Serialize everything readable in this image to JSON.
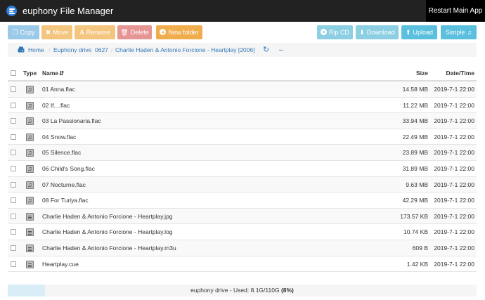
{
  "app": {
    "title": "euphony File Manager",
    "restart_label": "Restart Main App"
  },
  "toolbar": {
    "copy": "Copy",
    "move": "Move",
    "rename": "Rename",
    "delete": "Delete",
    "new_folder": "New folder",
    "rip_cd": "Rip CD",
    "download": "Download",
    "upload": "Upload",
    "simple": "Simple"
  },
  "breadcrumb": {
    "items": [
      "Home",
      "Euphony drive",
      "0627",
      "Charlie Haden & Antonio Forcione - Heartplay [2006]"
    ],
    "separator": "/"
  },
  "table": {
    "headers": {
      "type": "Type",
      "name": "Name",
      "size": "Size",
      "date": "Date/Time"
    },
    "rows": [
      {
        "name": "01 Anna.flac",
        "size": "14.58 MB",
        "date": "2019-7-1 22:00",
        "icon": "music-file-icon"
      },
      {
        "name": "02 If....flac",
        "size": "11.22 MB",
        "date": "2019-7-1 22:00",
        "icon": "music-file-icon"
      },
      {
        "name": "03 La Passionaria.flac",
        "size": "33.94 MB",
        "date": "2019-7-1 22:00",
        "icon": "music-file-icon"
      },
      {
        "name": "04 Snow.flac",
        "size": "22.49 MB",
        "date": "2019-7-1 22:00",
        "icon": "music-file-icon"
      },
      {
        "name": "05 Silence.flac",
        "size": "23.89 MB",
        "date": "2019-7-1 22:00",
        "icon": "music-file-icon"
      },
      {
        "name": "06 Child's Song.flac",
        "size": "31.89 MB",
        "date": "2019-7-1 22:00",
        "icon": "music-file-icon"
      },
      {
        "name": "07 Nocturne.flac",
        "size": "9.63 MB",
        "date": "2019-7-1 22:00",
        "icon": "music-file-icon"
      },
      {
        "name": "08 For Turiya.flac",
        "size": "42.29 MB",
        "date": "2019-7-1 22:00",
        "icon": "music-file-icon"
      },
      {
        "name": "Charlie Haden & Antonio Forcione - Heartplay.jpg",
        "size": "173.57 KB",
        "date": "2019-7-1 22:00",
        "icon": "file-icon"
      },
      {
        "name": "Charlie Haden & Antonio Forcione - Heartplay.log",
        "size": "10.74 KB",
        "date": "2019-7-1 22:00",
        "icon": "file-icon"
      },
      {
        "name": "Charlie Haden & Antonio Forcione - Heartplay.m3u",
        "size": "609 B",
        "date": "2019-7-1 22:00",
        "icon": "file-icon"
      },
      {
        "name": "Heartplay.cue",
        "size": "1.42 KB",
        "date": "2019-7-1 22:00",
        "icon": "file-icon"
      }
    ]
  },
  "usage": {
    "prefix": "euphony drive - Used: 8.1G/110G ",
    "percent_text": "(8%)",
    "fraction": 0.08
  },
  "colors": {
    "topbar": "#222222",
    "copy": "#9bc9e8",
    "move": "#f3c57e",
    "delete": "#e59593",
    "new_folder": "#f0ad4e",
    "info": "#5bc0de",
    "link": "#337ab7"
  }
}
